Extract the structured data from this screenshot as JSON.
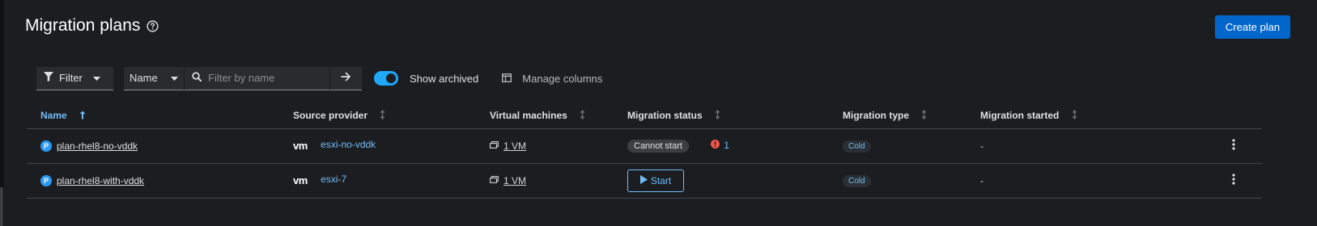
{
  "page": {
    "title": "Migration plans",
    "create_button_label": "Create plan"
  },
  "toolbar": {
    "filter_label": "Filter",
    "name_selector_label": "Name",
    "search_placeholder": "Filter by name",
    "show_archived_label": "Show archived",
    "show_archived_on": true,
    "manage_columns_label": "Manage columns"
  },
  "table": {
    "columns": {
      "name": "Name",
      "source_provider": "Source provider",
      "virtual_machines": "Virtual machines",
      "migration_status": "Migration status",
      "migration_type": "Migration type",
      "migration_started": "Migration started"
    },
    "rows": [
      {
        "badge": "P",
        "name": "plan-rhel8-no-vddk",
        "provider_logo": "vm",
        "provider": "esxi-no-vddk",
        "vms": "1 VM",
        "status": "Cannot start",
        "error_count": "1",
        "type": "Cold",
        "started": "-"
      },
      {
        "badge": "P",
        "name": "plan-rhel8-with-vddk",
        "provider_logo": "vm",
        "provider": "esxi-7",
        "vms": "1 VM",
        "start_label": "Start",
        "type": "Cold",
        "started": "-"
      }
    ]
  },
  "colors": {
    "accent": "#0066cc",
    "link": "#73bcf7",
    "toggle": "#1fa7f8",
    "error": "#f0554a",
    "background": "#1b1d21"
  },
  "icons": [
    "help-icon",
    "filter-icon",
    "caret-down-icon",
    "search-icon",
    "arrow-right-icon",
    "columns-icon",
    "sort-up-icon",
    "sort-icon",
    "vm-icon",
    "error-icon",
    "play-icon",
    "kebab-icon"
  ]
}
